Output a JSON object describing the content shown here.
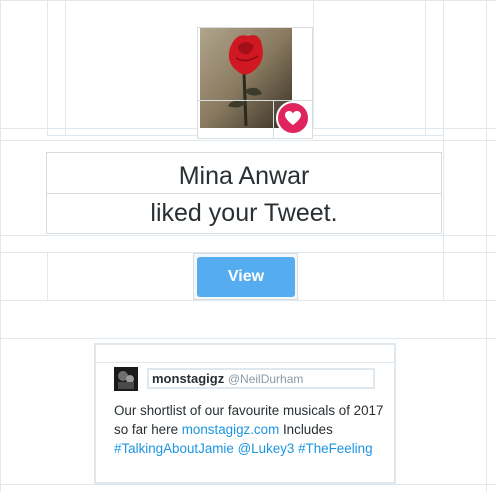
{
  "notification": {
    "actor_name": "Mina Anwar",
    "action_text": "liked your Tweet.",
    "button_label": "View"
  },
  "tweet": {
    "author_name": "monstagigz",
    "author_handle": "@NeilDurham",
    "text_before_link": "Our shortlist of our favourite musicals of 2017 so far here ",
    "link_text": "monstagigz.com",
    "text_after_link": " Includes",
    "hashtag1": "#TalkingAboutJamie",
    "mention": "@Lukey3",
    "hashtag2": "#TheFeeling"
  },
  "colors": {
    "like_badge": "#e0245e",
    "button": "#55acee",
    "link": "#1b95e0",
    "border": "#e1e8ed"
  },
  "icons": {
    "like": "heart-icon",
    "avatar": "rose-avatar-image"
  }
}
